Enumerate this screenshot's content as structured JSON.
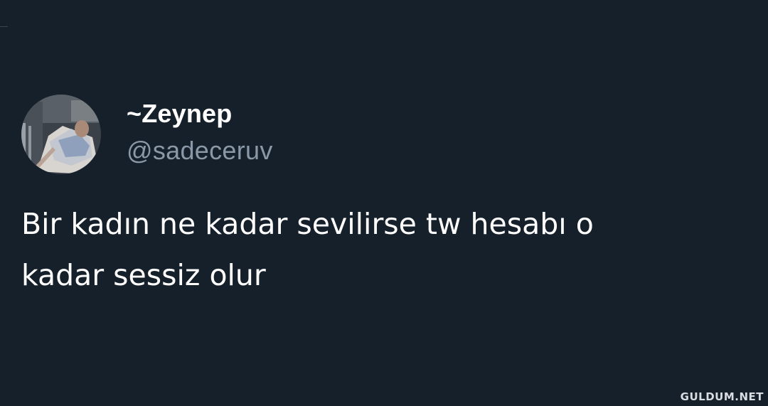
{
  "user": {
    "display_name": "~Zeynep",
    "handle": "@sadeceruv"
  },
  "tweet": {
    "text_lines": [
      "Bir kadın ne kadar sevilirse tw hesabı o",
      "kadar sessiz olur"
    ]
  },
  "watermark": "GULDUM.NET",
  "colors": {
    "background": "#15202b",
    "text_primary": "#ffffff",
    "text_secondary": "#8b98a5"
  }
}
